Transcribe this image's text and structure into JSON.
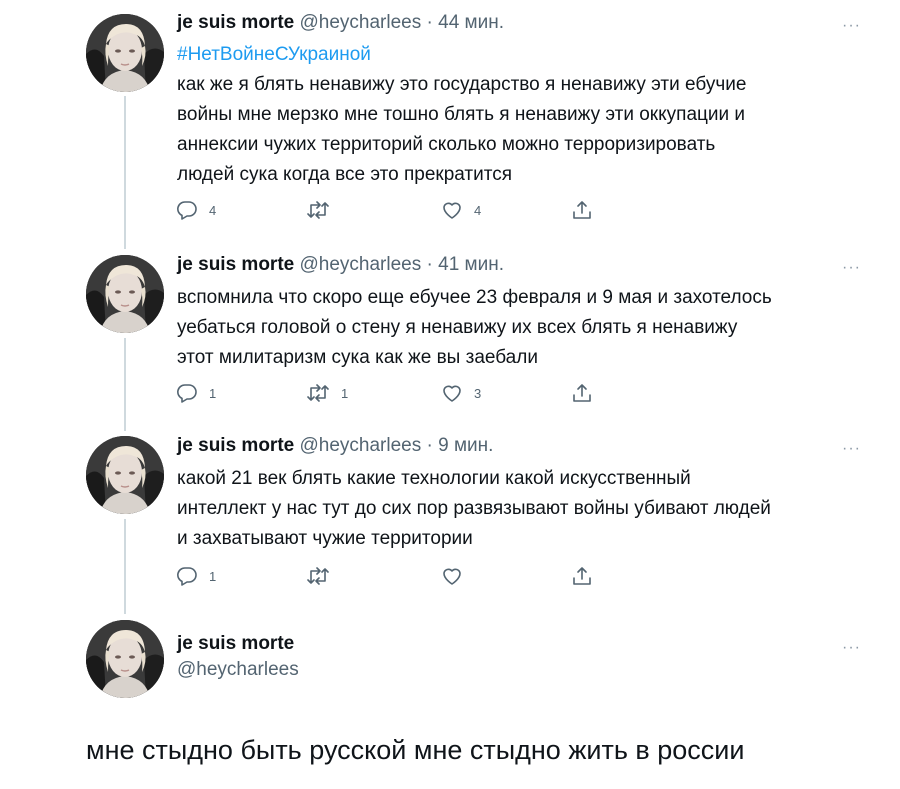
{
  "tweets": [
    {
      "name": "je suis morte",
      "handle": "@heycharlees",
      "dot": "·",
      "time": "44 мин.",
      "more": "···",
      "hashtag": "#НетВойнеСУкраиной",
      "lines": [
        "как же я блять ненавижу это государство я ненавижу эти ебучие",
        "войны мне мерзко мне тошно блять я ненавижу эти оккупации и",
        "аннексии чужих территорий сколько можно терроризировать",
        "людей сука когда все это прекратится"
      ],
      "reply_count": "4",
      "retweet_count": "",
      "like_count": "4"
    },
    {
      "name": "je suis morte",
      "handle": "@heycharlees",
      "dot": "·",
      "time": "41 мин.",
      "more": "···",
      "lines": [
        "вспомнила что скоро еще ебучее 23 февраля и 9 мая и захотелось",
        "уебаться головой о стену я ненавижу их всех блять я ненавижу",
        "этот милитаризм сука как же вы заебали"
      ],
      "reply_count": "1",
      "retweet_count": "1",
      "like_count": "3"
    },
    {
      "name": "je suis morte",
      "handle": "@heycharlees",
      "dot": "·",
      "time": "9 мин.",
      "more": "···",
      "lines": [
        "какой 21 век блять какие технологии какой искусственный",
        "интеллект у нас тут до сих пор развязывают войны убивают людей",
        "и захватывают чужие территории"
      ],
      "reply_count": "1",
      "retweet_count": "",
      "like_count": ""
    }
  ],
  "final_tweet": {
    "name": "je suis morte",
    "handle": "@heycharlees",
    "more": "···",
    "text": "мне стыдно быть русской мне стыдно жить в россии"
  },
  "icons": {
    "reply": "reply-icon",
    "retweet": "retweet-icon",
    "like": "heart-icon",
    "share": "share-icon",
    "more": "more-icon"
  },
  "colors": {
    "hashtag": "#1d9bf0",
    "secondary_text": "#536471",
    "thread_line": "#cfd9de"
  }
}
